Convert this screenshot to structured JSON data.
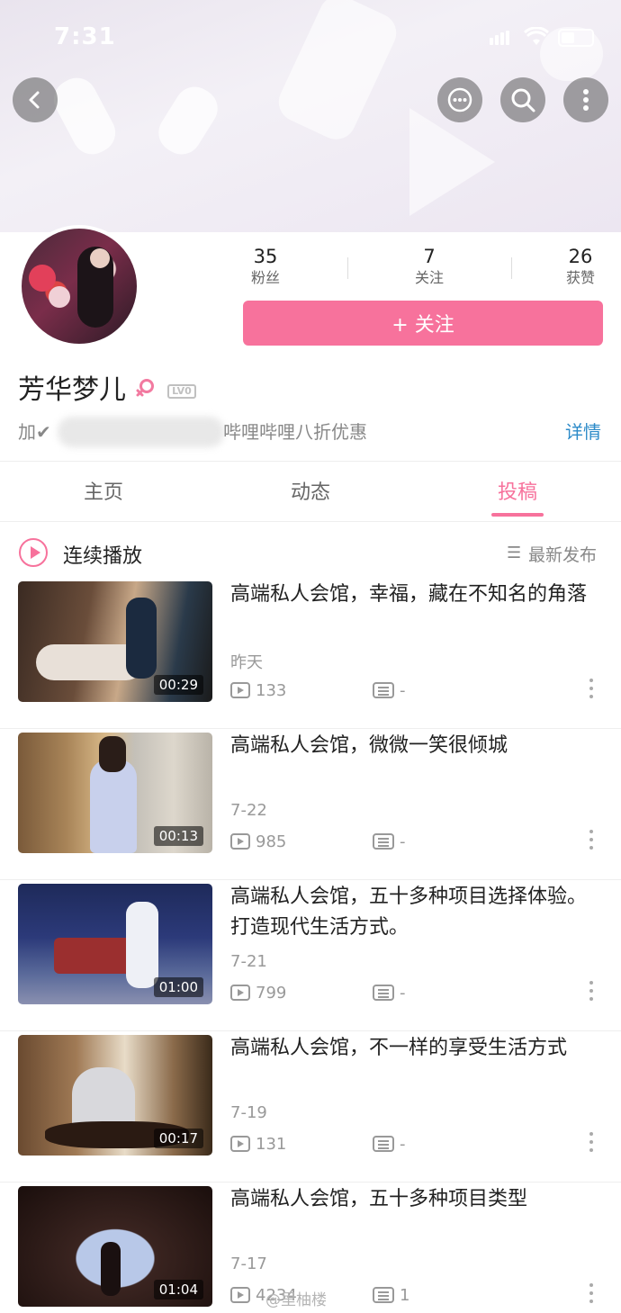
{
  "status_bar": {
    "time": "7:31"
  },
  "header": {
    "back_icon": "back-icon",
    "message_icon": "message-icon",
    "search_icon": "search-icon",
    "more_icon": "more-icon"
  },
  "profile": {
    "stats": [
      {
        "value": "35",
        "label": "粉丝"
      },
      {
        "value": "7",
        "label": "关注"
      },
      {
        "value": "26",
        "label": "获赞"
      }
    ],
    "follow_button": "+ 关注",
    "name": "芳华梦儿",
    "gender_icon": "female-icon",
    "level": "LV0",
    "signature_prefix": "加✔",
    "signature_suffix": "哔哩哔哩八折优惠",
    "detail_link": "详情"
  },
  "tabs": [
    {
      "label": "主页",
      "active": false
    },
    {
      "label": "动态",
      "active": false
    },
    {
      "label": "投稿",
      "active": true
    }
  ],
  "playlist": {
    "label": "连续播放",
    "sort_label": "最新发布"
  },
  "videos": [
    {
      "title": "高端私人会馆，幸福，藏在不知名的角落",
      "date": "昨天",
      "plays": "133",
      "danmaku": "-",
      "duration": "00:29"
    },
    {
      "title": "高端私人会馆，微微一笑很倾城",
      "date": "7-22",
      "plays": "985",
      "danmaku": "-",
      "duration": "00:13"
    },
    {
      "title": "高端私人会馆，五十多种项目选择体验。打造现代生活方式。",
      "date": "7-21",
      "plays": "799",
      "danmaku": "-",
      "duration": "01:00"
    },
    {
      "title": "高端私人会馆，不一样的享受生活方式",
      "date": "7-19",
      "plays": "131",
      "danmaku": "-",
      "duration": "00:17"
    },
    {
      "title": "高端私人会馆，五十多种项目类型",
      "date": "7-17",
      "plays": "4234",
      "danmaku": "1",
      "duration": "01:04"
    }
  ],
  "watermark": "@里柚楼",
  "colors": {
    "accent": "#f7729c",
    "link": "#2d8bc9",
    "text": "#222222",
    "muted": "#999999"
  }
}
